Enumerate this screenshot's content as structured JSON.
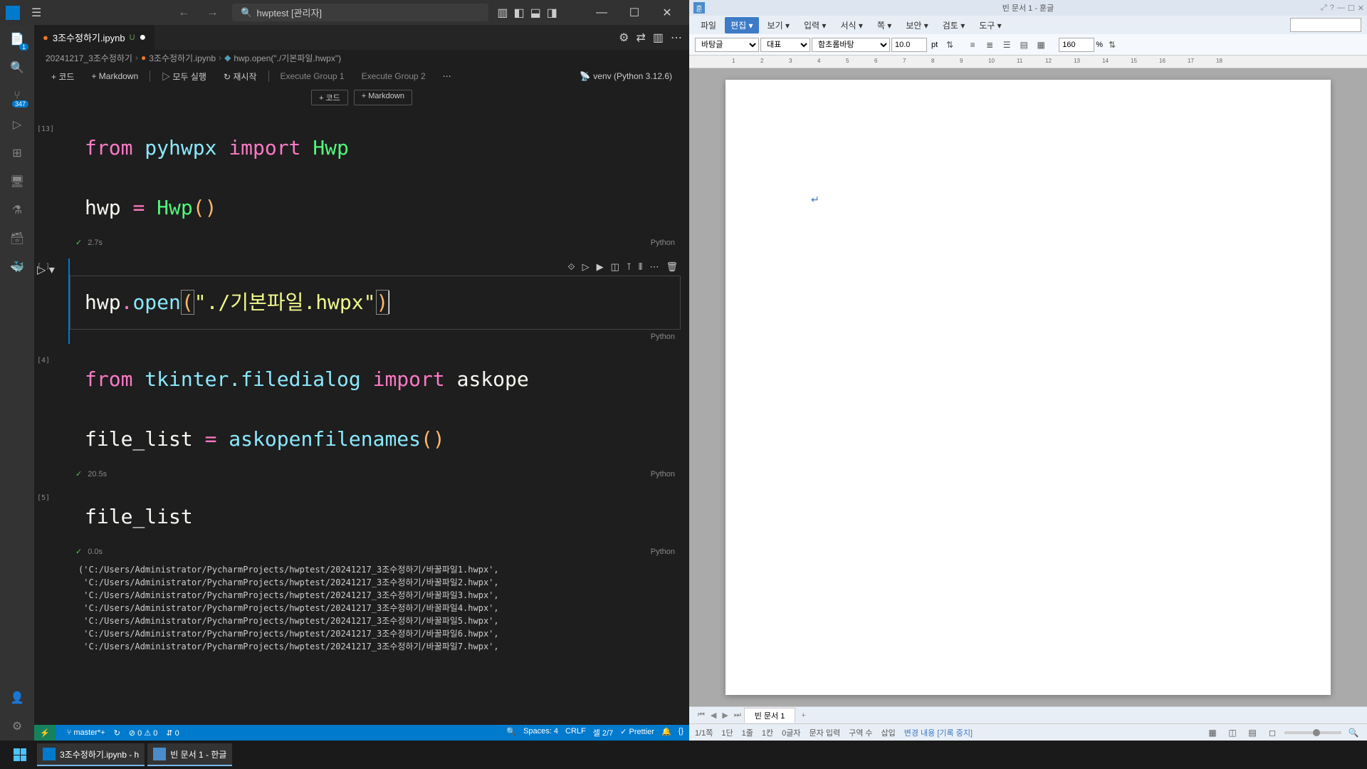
{
  "vscode": {
    "search": "hwptest [관리자]",
    "tab": {
      "name": "3조수정하기.ipynb",
      "badge": "U"
    },
    "breadcrumb": [
      "20241217_3조수정하기",
      "3조수정하기.ipynb",
      "hwp.open(\"./기본파일.hwpx\")"
    ],
    "notebook_toolbar": {
      "code": "+ 코드",
      "markdown": "+ Markdown",
      "run_all": "▷ 모두 실행",
      "restart": "↻ 재시작",
      "group1": "Execute Group 1",
      "group2": "Execute Group 2",
      "kernel": "venv (Python 3.12.6)"
    },
    "add_btns": {
      "code": "+ 코드",
      "markdown": "+ Markdown"
    },
    "cells": {
      "c1": {
        "exec": "[13]",
        "time": "2.7s",
        "lang": "Python"
      },
      "c2": {
        "exec": "[ ]",
        "lang": "Python"
      },
      "c3": {
        "exec": "[4]",
        "time": "20.5s",
        "lang": "Python"
      },
      "c4": {
        "exec": "[5]",
        "time": "0.0s",
        "lang": "Python"
      }
    },
    "output": "('C:/Users/Administrator/PycharmProjects/hwptest/20241217_3조수정하기/바꿀파일1.hwpx',\n 'C:/Users/Administrator/PycharmProjects/hwptest/20241217_3조수정하기/바꿀파일2.hwpx',\n 'C:/Users/Administrator/PycharmProjects/hwptest/20241217_3조수정하기/바꿀파일3.hwpx',\n 'C:/Users/Administrator/PycharmProjects/hwptest/20241217_3조수정하기/바꿀파일4.hwpx',\n 'C:/Users/Administrator/PycharmProjects/hwptest/20241217_3조수정하기/바꿀파일5.hwpx',\n 'C:/Users/Administrator/PycharmProjects/hwptest/20241217_3조수정하기/바꿀파일6.hwpx',\n 'C:/Users/Administrator/PycharmProjects/hwptest/20241217_3조수정하기/바꿀파일7.hwpx',",
    "status": {
      "branch": "master*+",
      "errors": "⊘ 0 ⚠ 0",
      "ports": "⇵ 0",
      "spaces": "Spaces: 4",
      "eol": "CRLF",
      "cell": "셀 2/7",
      "prettier": "✓ Prettier"
    },
    "activity_badge": "347"
  },
  "hangul": {
    "title": "빈 문서 1 - 훈글",
    "menus": [
      "파일",
      "편집",
      "보기",
      "입력",
      "서식",
      "쪽",
      "보안",
      "검토",
      "도구"
    ],
    "toolbar": {
      "style": "바탕글",
      "rep": "대표",
      "font": "함초롬바탕",
      "size": "10.0",
      "unit": "pt",
      "zoom": "160",
      "pct": "%"
    },
    "tab": "빈 문서 1",
    "status": [
      "1/1쪽",
      "1단",
      "1줄",
      "1칸",
      "0글자",
      "문자 입력",
      "구역 수",
      "삽입",
      "변경 내용 [기록 중지]"
    ]
  },
  "taskbar": {
    "vscode": "3조수정하기.ipynb - h",
    "hangul": "빈 문서 1 - 한글"
  }
}
